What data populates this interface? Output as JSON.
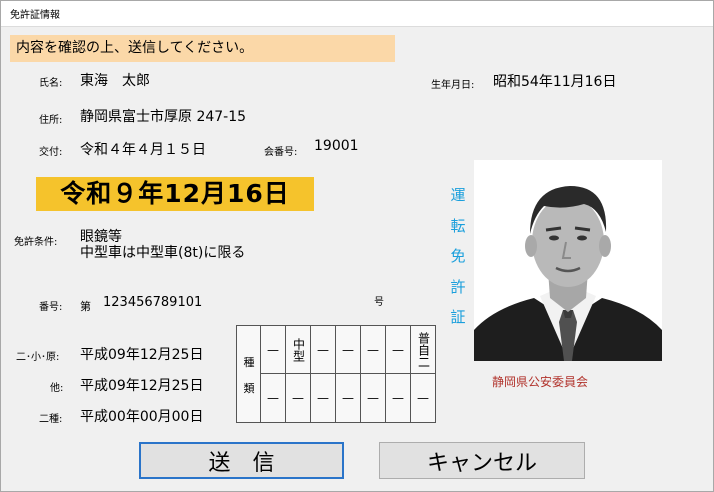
{
  "window": {
    "title": "免許証情報"
  },
  "banner": "内容を確認の上、送信してください。",
  "fields": {
    "name_label": "氏名:",
    "name": "東海　太郎",
    "birth_label": "生年月日:",
    "birth": "昭和54年11月16日",
    "address_label": "住所:",
    "address": "静岡県富士市厚原 247-15",
    "issue_label": "交付:",
    "issue": "令和４年４月１５日",
    "meeting_label": "会番号:",
    "meeting": "19001",
    "expiry": "令和９年12月16日",
    "conditions_label": "免許条件:",
    "conditions_line1": "眼鏡等",
    "conditions_line2": "中型車は中型車(8t)に限る",
    "number_label": "番号:",
    "number_prefix": "第",
    "number": "123456789101",
    "number_suffix": "号",
    "nishogen_label": "二･小･原:",
    "nishogen": "平成09年12月25日",
    "other_label": "他:",
    "other": "平成09年12月25日",
    "second_label": "二種:",
    "second": "平成00年00月00日"
  },
  "vertical_title": [
    "運",
    "転",
    "免",
    "許",
    "証"
  ],
  "issuer": "静岡県公安委員会",
  "grid": {
    "row_label_top": "種",
    "row_label_bottom": "類",
    "top": [
      "—",
      "中型",
      "—",
      "—",
      "—",
      "—",
      "普自二"
    ],
    "bottom": [
      "—",
      "—",
      "—",
      "—",
      "—",
      "—",
      "—"
    ]
  },
  "buttons": {
    "send": "送　信",
    "cancel": "キャンセル"
  },
  "colors": {
    "banner": "#fbd8a8",
    "expiry": "#f5c32c",
    "vertical": "#1a9fdc",
    "issuer": "#b1322b",
    "focus": "#2a74c9"
  }
}
